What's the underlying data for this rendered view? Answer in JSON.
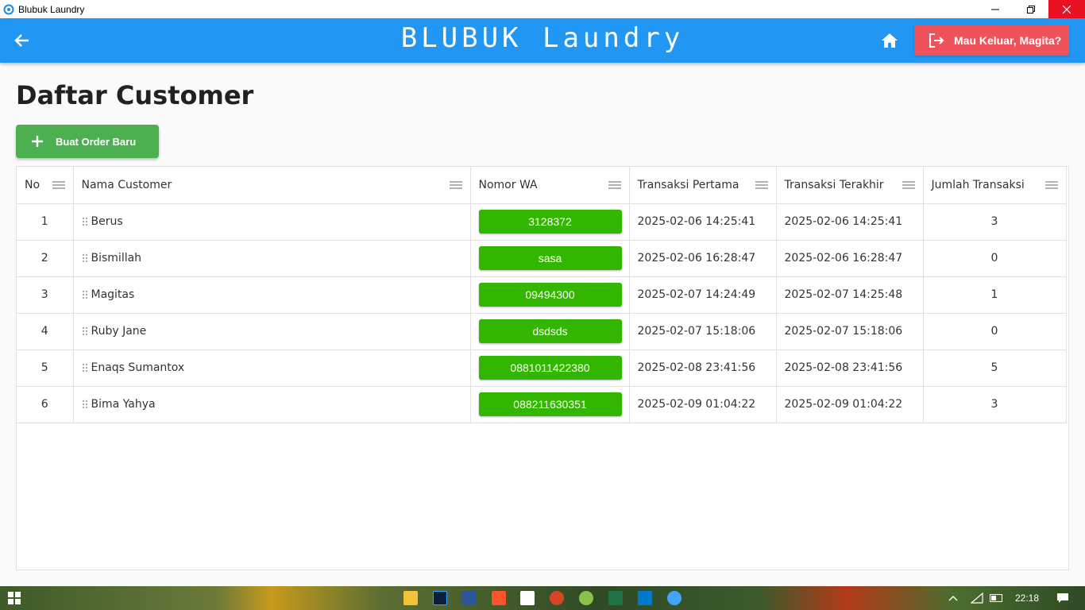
{
  "window": {
    "title": "Blubuk Laundry"
  },
  "appbar": {
    "brand": "BLUBUK Laundry",
    "logout_label": "Mau Keluar, Magita?",
    "color": "#2196f3",
    "logout_color": "#f0525c"
  },
  "page": {
    "title": "Daftar Customer",
    "new_order_label": "Buat Order Baru"
  },
  "table": {
    "columns": [
      "No",
      "Nama Customer",
      "Nomor WA",
      "Transaksi Pertama",
      "Transaksi Terakhir",
      "Jumlah Transaksi"
    ],
    "rows": [
      {
        "no": "1",
        "name": "Berus",
        "wa": "3128372",
        "first": "2025-02-06 14:25:41",
        "last": "2025-02-06 14:25:41",
        "count": "3"
      },
      {
        "no": "2",
        "name": "Bismillah",
        "wa": "sasa",
        "first": "2025-02-06 16:28:47",
        "last": "2025-02-06 16:28:47",
        "count": "0"
      },
      {
        "no": "3",
        "name": "Magitas",
        "wa": "09494300",
        "first": "2025-02-07 14:24:49",
        "last": "2025-02-07 14:25:48",
        "count": "1"
      },
      {
        "no": "4",
        "name": "Ruby Jane",
        "wa": "dsdsds",
        "first": "2025-02-07 15:18:06",
        "last": "2025-02-07 15:18:06",
        "count": "0"
      },
      {
        "no": "5",
        "name": "Enaqs Sumantox",
        "wa": "0881011422380",
        "first": "2025-02-08 23:41:56",
        "last": "2025-02-08 23:41:56",
        "count": "5"
      },
      {
        "no": "6",
        "name": "Bima Yahya",
        "wa": "088211630351",
        "first": "2025-02-09 01:04:22",
        "last": "2025-02-09 01:04:22",
        "count": "3"
      }
    ]
  },
  "taskbar": {
    "time": "22:18"
  }
}
